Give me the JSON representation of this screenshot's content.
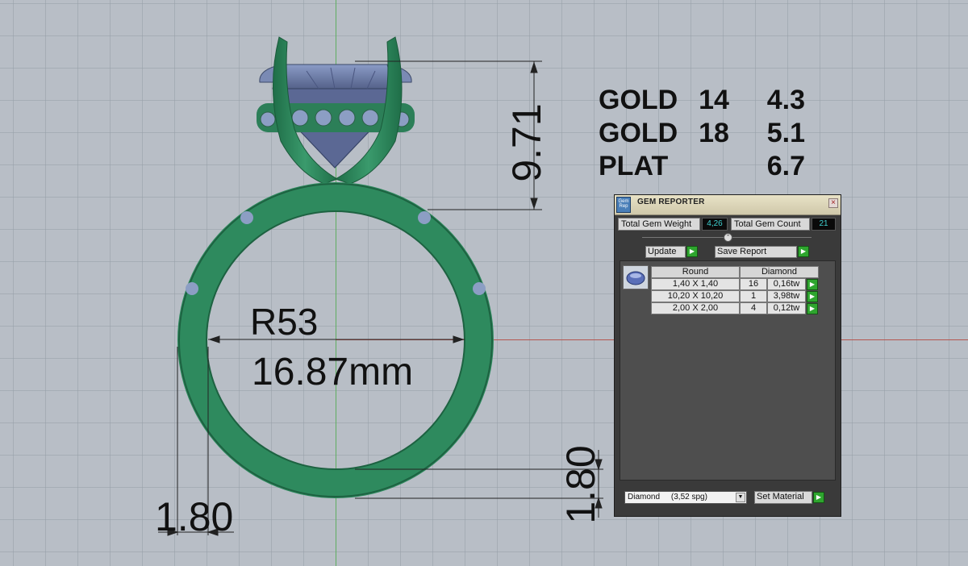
{
  "metal_weights": [
    {
      "metal": "GOLD",
      "karat": "14",
      "weight": "4.3"
    },
    {
      "metal": "GOLD",
      "karat": "18",
      "weight": "5.1"
    },
    {
      "metal": "PLAT",
      "karat": "",
      "weight": "6.7"
    }
  ],
  "dimensions": {
    "head_height": "9.71",
    "ring_size": "R53",
    "inner_diameter": "16.87mm",
    "shank_width": "1.80",
    "shank_thickness": "1.80"
  },
  "gem_reporter": {
    "title": "GEM REPORTER",
    "icon_text": "Gem Rep",
    "close_glyph": "×",
    "total_weight_label": "Total Gem Weight",
    "total_weight_value": "4,26",
    "total_count_label": "Total Gem Count",
    "total_count_value": "21",
    "collapse_glyph": "⌃",
    "update_label": "Update",
    "save_report_label": "Save Report",
    "go_glyph": "▶",
    "table": {
      "headers": [
        "Round",
        "Diamond"
      ],
      "rows": [
        {
          "size": "1,40 X 1,40",
          "count": "16",
          "weight": "0,16tw"
        },
        {
          "size": "10,20 X 10,20",
          "count": "1",
          "weight": "3,98tw"
        },
        {
          "size": "2,00 X 2,00",
          "count": "4",
          "weight": "0,12tw"
        }
      ]
    },
    "material_select": "Diamond     (3,52 spg)",
    "select_arrow": "▼",
    "set_material_label": "Set Material"
  },
  "colors": {
    "metal": "#2e8a5e",
    "gem": "#6f7fa8",
    "axis_x": "#b5554f",
    "axis_y": "#5fae62",
    "background": "#b8bec6"
  }
}
